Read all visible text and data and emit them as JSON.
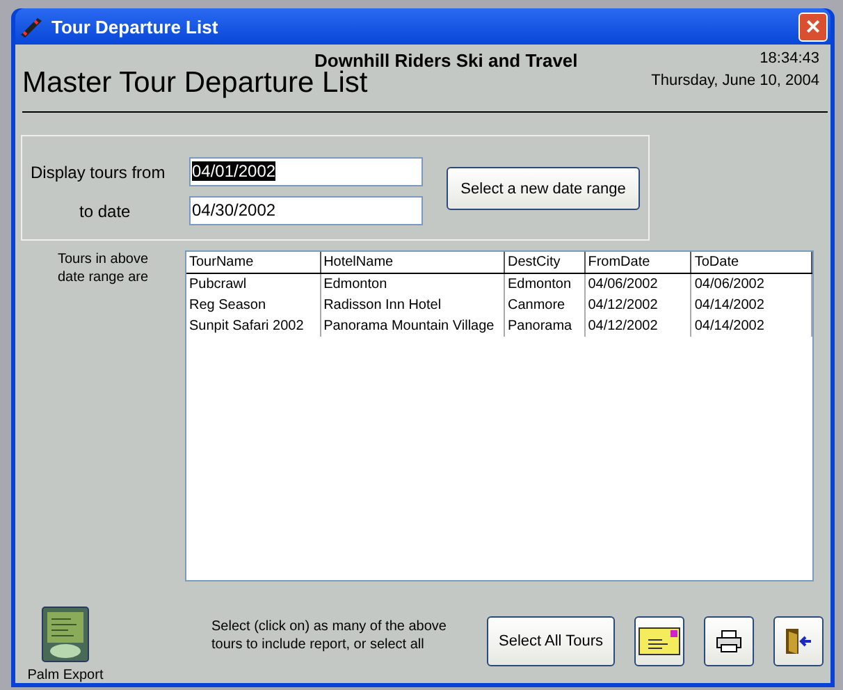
{
  "window": {
    "title": "Tour Departure List",
    "close_label": "×"
  },
  "header": {
    "company": "Downhill Riders Ski and Travel",
    "title": "Master Tour Departure List",
    "time": "18:34:43",
    "date": "Thursday, June 10, 2004"
  },
  "filter": {
    "from_label": "Display tours from",
    "from_value": "04/01/2002",
    "from_text_selected": true,
    "to_label": "to date",
    "to_value": "04/30/2002",
    "button": "Select a new date range"
  },
  "table": {
    "label": "Tours in above date range are",
    "columns": [
      "TourName",
      "HotelName",
      "DestCity",
      "FromDate",
      "ToDate"
    ],
    "rows": [
      [
        "Pubcrawl",
        "Edmonton",
        "Edmonton",
        "04/06/2002",
        "04/06/2002"
      ],
      [
        "Reg Season",
        "Radisson Inn Hotel",
        "Canmore",
        "04/12/2002",
        "04/14/2002"
      ],
      [
        "Sunpit Safari 2002",
        "Panorama Mountain Village",
        "Panorama",
        "04/12/2002",
        "04/14/2002"
      ]
    ]
  },
  "footer": {
    "palm_label": "Palm Export",
    "hint": "Select (click on) as many of the above tours to include report, or select all",
    "select_all": "Select All Tours"
  }
}
